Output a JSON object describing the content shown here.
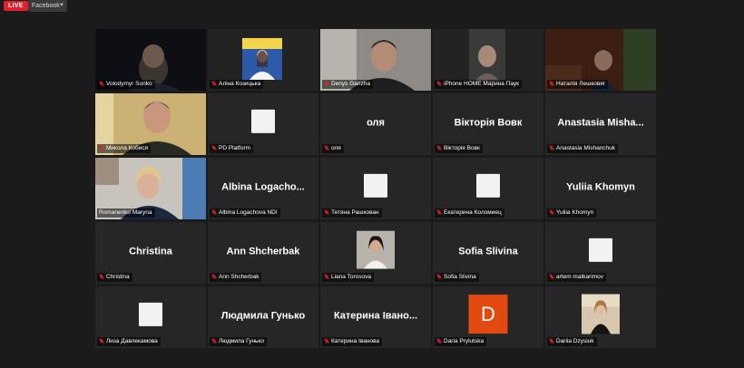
{
  "topbar": {
    "live_label": "LIVE",
    "stream_target": "Facebook"
  },
  "participants": [
    {
      "label": "Volodymyr Sonko",
      "display": "video"
    },
    {
      "label": "Аліна Козицька",
      "display": "video"
    },
    {
      "label": "Denys Ganzha",
      "display": "video"
    },
    {
      "label": "iPhone HOME Марина Паук",
      "display": "video"
    },
    {
      "label": "Наталія Лешковяг",
      "display": "video"
    },
    {
      "label": "Микола Кобися",
      "display": "video"
    },
    {
      "label": "PD Platform",
      "display": "avatar"
    },
    {
      "label": "оля",
      "display": "name",
      "big_name": "оля"
    },
    {
      "label": "Вікторія Вовк",
      "display": "name",
      "big_name": "Вікторія Вовк"
    },
    {
      "label": "Anastasia Mishanchuk",
      "display": "name",
      "big_name": "Anastasia  Misha..."
    },
    {
      "label": "Romanenko Maryna",
      "display": "video"
    },
    {
      "label": "Albina Logachova NDI",
      "display": "name",
      "big_name": "Albina  Logacho..."
    },
    {
      "label": "Тетяна Рашкован",
      "display": "avatar"
    },
    {
      "label": "Екатерина Коломиец",
      "display": "avatar"
    },
    {
      "label": "Yuliia Khomyn",
      "display": "name",
      "big_name": "Yuliia Khomyn"
    },
    {
      "label": "Christina",
      "display": "name",
      "big_name": "Christina"
    },
    {
      "label": "Ann Shcherbak",
      "display": "name",
      "big_name": "Ann Shcherbak"
    },
    {
      "label": "Liana Torosova",
      "display": "photo"
    },
    {
      "label": "Sofia Slivina",
      "display": "name",
      "big_name": "Sofia Slivina"
    },
    {
      "label": "artem matkarimov",
      "display": "avatar"
    },
    {
      "label": "Лиза Давлекамова",
      "display": "avatar"
    },
    {
      "label": "Людмила Гунько",
      "display": "name",
      "big_name": "Людмила Гунько"
    },
    {
      "label": "Катерина Іванова",
      "display": "name",
      "big_name": "Катерина Івано..."
    },
    {
      "label": "Daria Prylutska",
      "display": "initial",
      "initial": "D"
    },
    {
      "label": "Dariia Dzysiuk",
      "display": "photo"
    }
  ],
  "colors": {
    "active_speaker": "#9bd04a",
    "muted_icon": "#e0212b",
    "initial_bg": "#e24a10",
    "live": "#e0212b"
  }
}
